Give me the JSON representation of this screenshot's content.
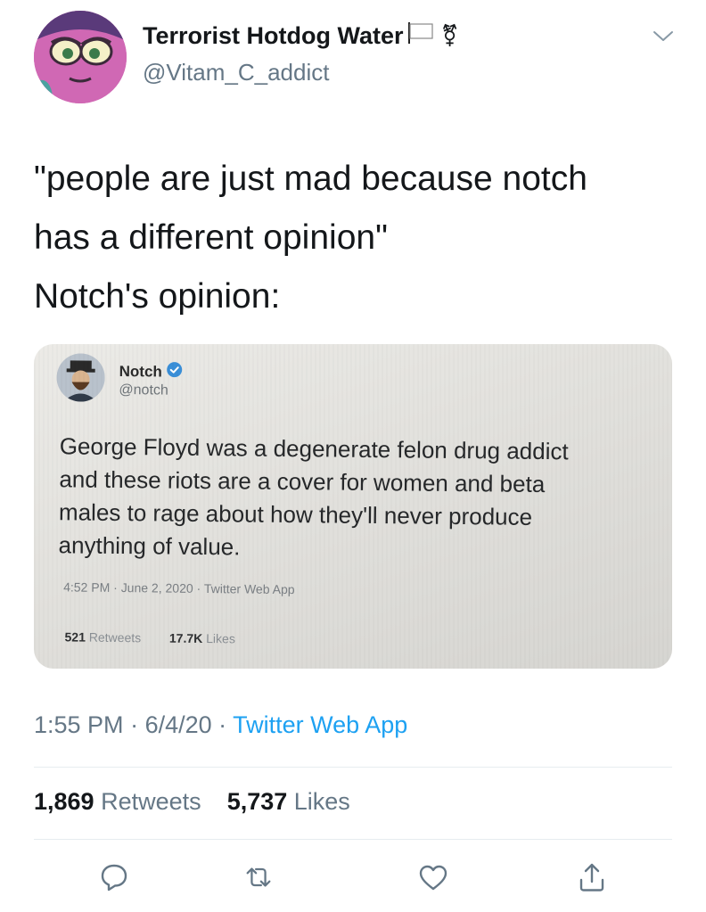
{
  "author": {
    "display_name": "Terrorist Hotdog Water",
    "flag_icon": "white-flag-icon",
    "symbol": "⚧",
    "handle": "@Vitam_C_addict"
  },
  "tweet": {
    "lines": [
      "\"people are just mad because notch",
      "has a different opinion\"",
      "Notch's opinion:"
    ],
    "time": "1:55 PM",
    "date": "6/4/20",
    "source": "Twitter Web App",
    "retweets": "1,869",
    "retweets_label": "Retweets",
    "likes": "5,737",
    "likes_label": "Likes"
  },
  "embedded": {
    "name": "Notch",
    "handle": "@notch",
    "lines": [
      "George Floyd was a degenerate felon drug addict",
      "and these riots are a cover for women and beta",
      "males to rage about how they'll never produce",
      "anything of value."
    ],
    "time": "4:52 PM",
    "date": "June 2, 2020",
    "source": "Twitter Web App",
    "retweets": "521",
    "retweets_label": "Retweets",
    "likes": "17.7K",
    "likes_label": "Likes"
  },
  "separator": " · ",
  "actions": [
    "reply-icon",
    "retweet-icon",
    "like-icon",
    "share-icon"
  ],
  "colors": {
    "link": "#1da1f2",
    "secondary_text": "#657786",
    "avatar_bg": "#cf5fae",
    "icon": "#657786"
  }
}
